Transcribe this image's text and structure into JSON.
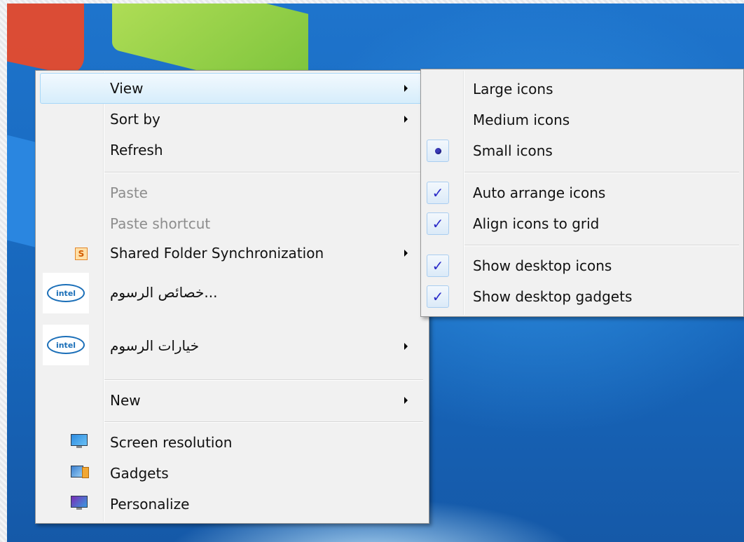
{
  "context_menu": {
    "items": [
      {
        "label": "View"
      },
      {
        "label": "Sort by"
      },
      {
        "label": "Refresh"
      },
      {
        "label": "Paste"
      },
      {
        "label": "Paste shortcut"
      },
      {
        "label": "Shared Folder Synchronization"
      },
      {
        "label": "...خصائص الرسوم"
      },
      {
        "label": "خيارات الرسوم"
      },
      {
        "label": "New"
      },
      {
        "label": "Screen resolution"
      },
      {
        "label": "Gadgets"
      },
      {
        "label": "Personalize"
      }
    ],
    "intel_logo_text": "intel",
    "s_icon_text": "S"
  },
  "view_submenu": {
    "items": [
      {
        "label": "Large icons",
        "state": "none"
      },
      {
        "label": "Medium icons",
        "state": "none"
      },
      {
        "label": "Small icons",
        "state": "radio"
      },
      {
        "label": "Auto arrange icons",
        "state": "checked"
      },
      {
        "label": "Align icons to grid",
        "state": "checked"
      },
      {
        "label": "Show desktop icons",
        "state": "checked"
      },
      {
        "label": "Show desktop gadgets",
        "state": "checked"
      }
    ],
    "check_glyph": "✓"
  },
  "colors": {
    "desktop": "#1d73c9",
    "menu_bg": "#f1f1f1",
    "check": "#2a2ac8"
  }
}
